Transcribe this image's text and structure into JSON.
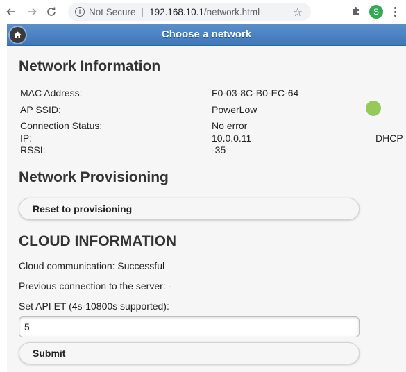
{
  "browser": {
    "security_label": "Not Secure",
    "separator": "|",
    "url_host": "192.168.10.1",
    "url_path": "/network.html",
    "profile_initial": "S"
  },
  "header": {
    "title": "Choose a network"
  },
  "network_info": {
    "heading": "Network Information",
    "rows": [
      {
        "label": "MAC Address:",
        "value": "F0-03-8C-B0-EC-64"
      },
      {
        "label": "AP SSID:",
        "value": "PowerLow"
      },
      {
        "label": "Connection Status:",
        "value": "No error"
      },
      {
        "label": "IP:",
        "value": "10.0.0.11",
        "extra": "DHCP"
      },
      {
        "label": "RSSI:",
        "value": "-35"
      }
    ],
    "status_color": "#95c95a"
  },
  "provisioning": {
    "heading": "Network Provisioning",
    "reset_button": "Reset to provisioning"
  },
  "cloud": {
    "heading": "CLOUD INFORMATION",
    "communication": "Cloud communication: Successful",
    "previous_connection": "Previous connection to the server: -",
    "api_et_label": "Set API ET (4s-10800s supported):",
    "api_et_value": "5",
    "submit_button": "Submit"
  },
  "colors": {
    "header_gradient_top": "#5a8fcb",
    "header_gradient_bottom": "#3f77b8",
    "panel_background": "#f6f6f6"
  },
  "icons": {
    "back": "back-arrow-icon",
    "forward": "forward-arrow-icon",
    "reload": "reload-icon",
    "info": "info-icon",
    "star": "star-icon",
    "extensions": "puzzle-icon",
    "menu": "kebab-menu-icon",
    "home": "home-icon"
  }
}
